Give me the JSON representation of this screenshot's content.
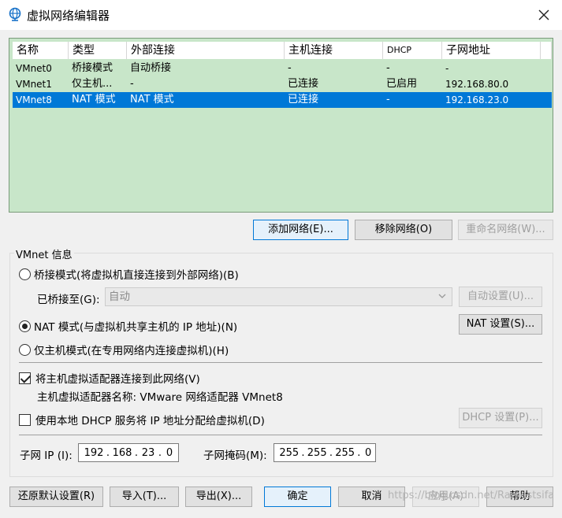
{
  "window": {
    "title": "虚拟网络编辑器",
    "close_glyph": "✕"
  },
  "table": {
    "headers": [
      "名称",
      "类型",
      "外部连接",
      "主机连接",
      "DHCP",
      "子网地址"
    ],
    "rows": [
      [
        "VMnet0",
        "桥接模式",
        "自动桥接",
        "-",
        "-",
        "-"
      ],
      [
        "VMnet1",
        "仅主机...",
        "-",
        "已连接",
        "已启用",
        "192.168.80.0"
      ],
      [
        "VMnet8",
        "NAT 模式",
        "NAT 模式",
        "已连接",
        "-",
        "192.168.23.0"
      ]
    ],
    "selected_row": 2
  },
  "buttons": {
    "add_network": "添加网络(E)...",
    "remove_network": "移除网络(O)",
    "rename_network": "重命名网络(W)...",
    "auto_settings": "自动设置(U)...",
    "nat_settings": "NAT 设置(S)...",
    "dhcp_settings": "DHCP 设置(P)...",
    "restore_defaults": "还原默认设置(R)",
    "import": "导入(T)...",
    "export": "导出(X)...",
    "ok": "确定",
    "cancel": "取消",
    "apply": "应用(A)",
    "help": "帮助"
  },
  "vmnet_info": {
    "legend": "VMnet 信息",
    "bridged_radio": "桥接模式(将虚拟机直接连接到外部网络)(B)",
    "bridged_to_label": "已桥接至(G):",
    "bridged_to_value": "自动",
    "nat_radio": "NAT 模式(与虚拟机共享主机的 IP 地址)(N)",
    "hostonly_radio": "仅主机模式(在专用网络内连接虚拟机)(H)",
    "connect_adapter_check": "将主机虚拟适配器连接到此网络(V)",
    "adapter_name": "主机虚拟适配器名称: VMware 网络适配器 VMnet8",
    "dhcp_check": "使用本地 DHCP 服务将 IP 地址分配给虚拟机(D)",
    "subnet_ip_label": "子网 IP (I):",
    "subnet_ip": [
      "192",
      "168",
      "23",
      "0"
    ],
    "subnet_mask_label": "子网掩码(M):",
    "subnet_mask": [
      "255",
      "255",
      "255",
      "0"
    ],
    "selected_mode": "nat",
    "connect_adapter_checked": true,
    "dhcp_checked": false
  },
  "watermark": "https://blog.csdn.net/Ramestsifa",
  "colors": {
    "table_bg": "#c8e6c9",
    "selection": "#0078d7"
  }
}
